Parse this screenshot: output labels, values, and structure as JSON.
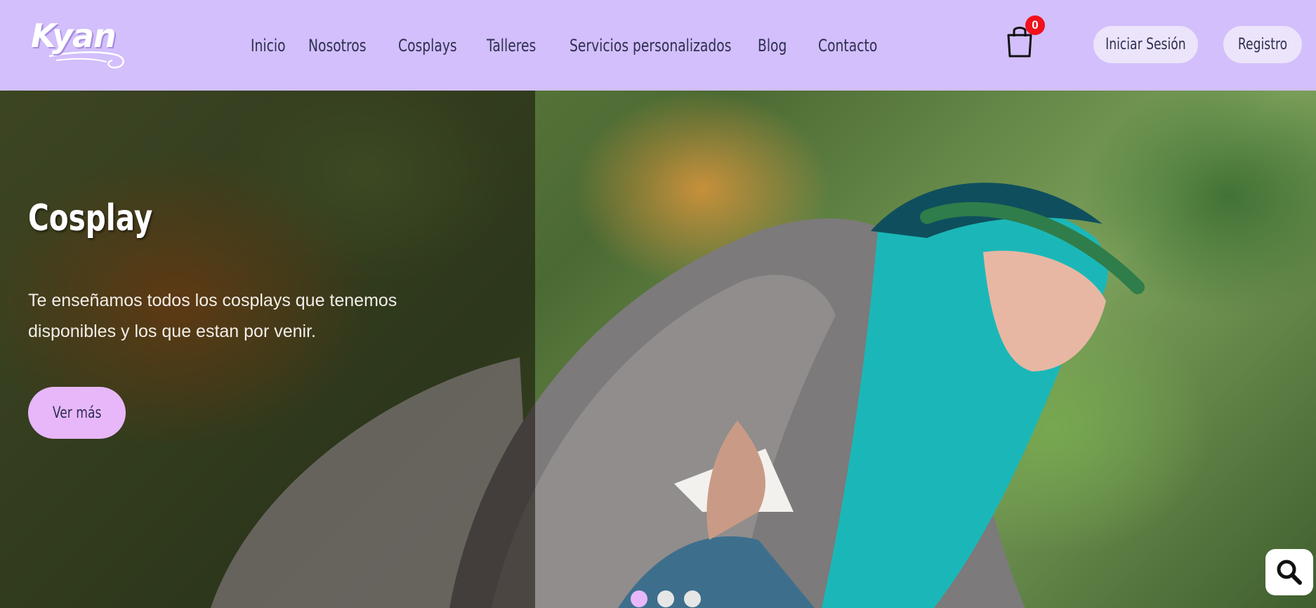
{
  "brand": {
    "logo_text": "Kyan",
    "colors": {
      "header_bg": "#d2bffb",
      "nav_text": "#2e2f52",
      "cta_bg": "#e8b7fa",
      "badge_bg": "#f0111c"
    }
  },
  "nav": {
    "items": [
      {
        "label": "Inicio"
      },
      {
        "label": "Nosotros"
      },
      {
        "label": "Cosplays"
      },
      {
        "label": "Talleres"
      },
      {
        "label": "Servicios personalizados"
      },
      {
        "label": "Blog"
      },
      {
        "label": "Contacto"
      }
    ]
  },
  "cart": {
    "icon": "shopping-bag-icon",
    "count": "0"
  },
  "auth": {
    "login_label": "Iniciar Sesión",
    "register_label": "Registro"
  },
  "hero": {
    "title": "Cosplay",
    "description": "Te enseñamos todos los cosplays que tenemos disponibles y los que estan por venir.",
    "cta_label": "Ver más",
    "slides_count": 3,
    "active_slide": 1
  },
  "floating": {
    "search_icon": "search-icon"
  }
}
